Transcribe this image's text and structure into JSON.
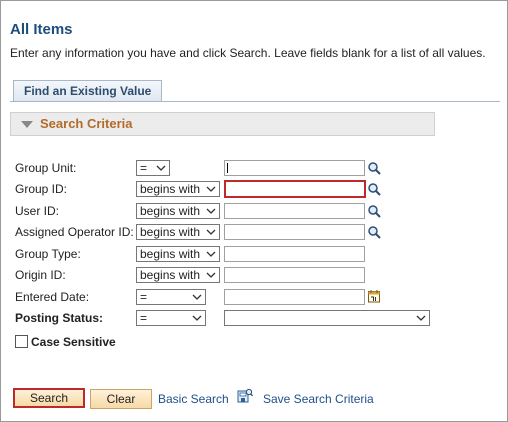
{
  "page": {
    "title": "All Items",
    "instructions": "Enter any information you have and click Search. Leave fields blank for a list of all values."
  },
  "tab": {
    "label": "Find an Existing Value"
  },
  "search_criteria": {
    "header": "Search Criteria",
    "fields": [
      {
        "label": "Group Unit:",
        "operator": "=",
        "value": ""
      },
      {
        "label": "Group ID:",
        "operator": "begins with",
        "value": ""
      },
      {
        "label": "User ID:",
        "operator": "begins with",
        "value": ""
      },
      {
        "label": "Assigned Operator ID:",
        "operator": "begins with",
        "value": ""
      },
      {
        "label": "Group Type:",
        "operator": "begins with",
        "value": ""
      },
      {
        "label": "Origin ID:",
        "operator": "begins with",
        "value": ""
      },
      {
        "label": "Entered Date:",
        "operator": "=",
        "value": ""
      },
      {
        "label": "Posting Status:",
        "operator": "=",
        "value": ""
      }
    ],
    "case_sensitive_label": "Case Sensitive",
    "case_sensitive_checked": false
  },
  "actions": {
    "search": "Search",
    "clear": "Clear",
    "basic_search": "Basic Search",
    "save_search_criteria": "Save Search Criteria"
  },
  "icons": {
    "lookup": "magnifier-icon",
    "calendar": "calendar-icon",
    "save_criteria": "save-criteria-icon"
  },
  "colors": {
    "title": "#1e4e7c",
    "section_header": "#b36b2b",
    "highlight_border": "#c0292b",
    "button_fill": "#f6d9a6",
    "link": "#1f4f8a"
  }
}
